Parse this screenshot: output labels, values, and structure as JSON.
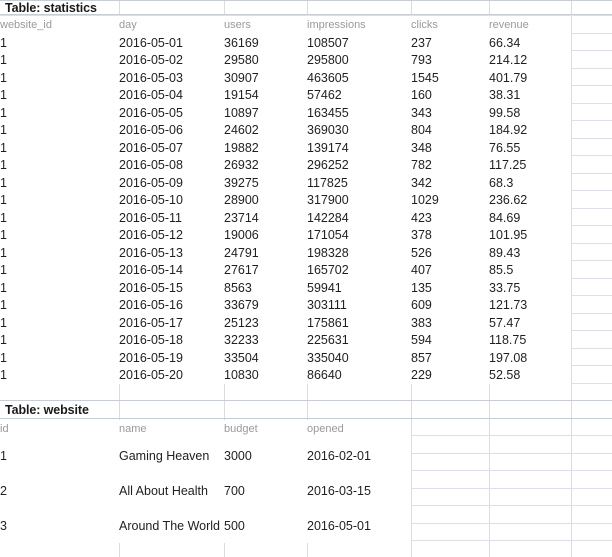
{
  "app": {
    "type": "spreadsheet",
    "grid_line_color": "#d9dce3",
    "header_text_color": "#9a9a9a",
    "data_text_color": "#1f1f1f"
  },
  "tables": [
    {
      "title": "Table: statistics",
      "columns": [
        "website_id",
        "day",
        "users",
        "impressions",
        "clicks",
        "revenue"
      ],
      "rows": [
        [
          "1",
          "2016-05-01",
          "36169",
          "108507",
          "237",
          "66.34"
        ],
        [
          "1",
          "2016-05-02",
          "29580",
          "295800",
          "793",
          "214.12"
        ],
        [
          "1",
          "2016-05-03",
          "30907",
          "463605",
          "1545",
          "401.79"
        ],
        [
          "1",
          "2016-05-04",
          "19154",
          "57462",
          "160",
          "38.31"
        ],
        [
          "1",
          "2016-05-05",
          "10897",
          "163455",
          "343",
          "99.58"
        ],
        [
          "1",
          "2016-05-06",
          "24602",
          "369030",
          "804",
          "184.92"
        ],
        [
          "1",
          "2016-05-07",
          "19882",
          "139174",
          "348",
          "76.55"
        ],
        [
          "1",
          "2016-05-08",
          "26932",
          "296252",
          "782",
          "117.25"
        ],
        [
          "1",
          "2016-05-09",
          "39275",
          "117825",
          "342",
          "68.3"
        ],
        [
          "1",
          "2016-05-10",
          "28900",
          "317900",
          "1029",
          "236.62"
        ],
        [
          "1",
          "2016-05-11",
          "23714",
          "142284",
          "423",
          "84.69"
        ],
        [
          "1",
          "2016-05-12",
          "19006",
          "171054",
          "378",
          "101.95"
        ],
        [
          "1",
          "2016-05-13",
          "24791",
          "198328",
          "526",
          "89.43"
        ],
        [
          "1",
          "2016-05-14",
          "27617",
          "165702",
          "407",
          "85.5"
        ],
        [
          "1",
          "2016-05-15",
          "8563",
          "59941",
          "135",
          "33.75"
        ],
        [
          "1",
          "2016-05-16",
          "33679",
          "303111",
          "609",
          "121.73"
        ],
        [
          "1",
          "2016-05-17",
          "25123",
          "175861",
          "383",
          "57.47"
        ],
        [
          "1",
          "2016-05-18",
          "32233",
          "225631",
          "594",
          "118.75"
        ],
        [
          "1",
          "2016-05-19",
          "33504",
          "335040",
          "857",
          "197.08"
        ],
        [
          "1",
          "2016-05-20",
          "10830",
          "86640",
          "229",
          "52.58"
        ]
      ]
    },
    {
      "title": "Table: website",
      "columns": [
        "id",
        "name",
        "budget",
        "opened"
      ],
      "rows": [
        [
          "1",
          "Gaming Heaven",
          "3000",
          "2016-02-01"
        ],
        [
          "2",
          "All About Health",
          "700",
          "2016-03-15"
        ],
        [
          "3",
          "Around The World",
          "500",
          "2016-05-01"
        ]
      ]
    }
  ]
}
